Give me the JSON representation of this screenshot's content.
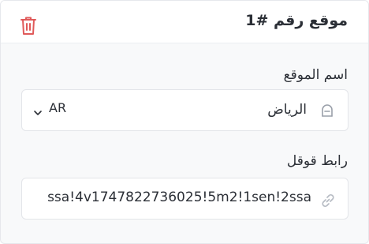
{
  "card": {
    "title": "موقع رقم #1",
    "delete_icon": "trash-icon",
    "accent_danger": "#e05a5a"
  },
  "name_field": {
    "label": "اسم الموقع",
    "value": "الرياض",
    "icon": "location-pin-icon",
    "language": "AR"
  },
  "link_field": {
    "label": "رابط قوقل",
    "value": "ssa!4v1747822736025!5m2!1sen!2ssa",
    "icon": "link-icon"
  }
}
